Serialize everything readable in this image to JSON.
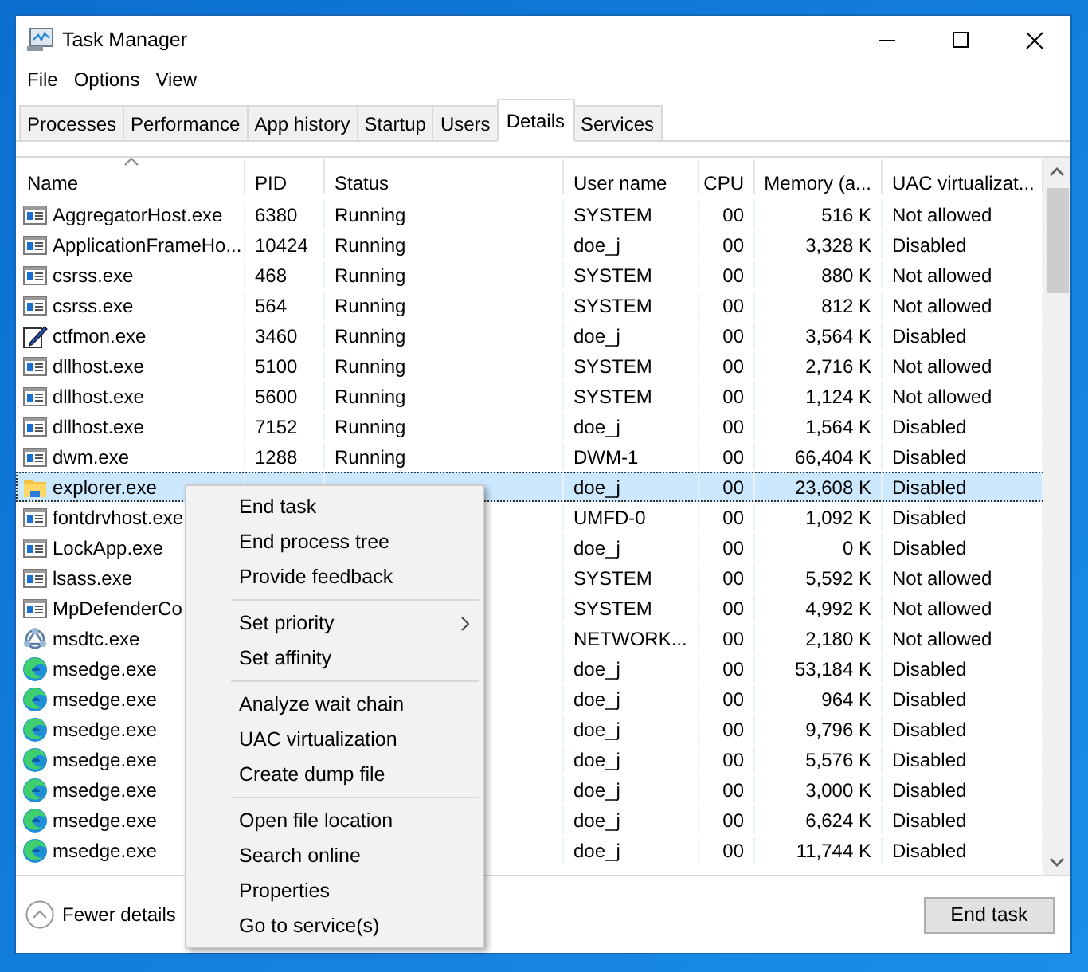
{
  "window": {
    "title": "Task Manager"
  },
  "menu_bar": [
    "File",
    "Options",
    "View"
  ],
  "tabs": [
    {
      "label": "Processes",
      "selected": false
    },
    {
      "label": "Performance",
      "selected": false
    },
    {
      "label": "App history",
      "selected": false
    },
    {
      "label": "Startup",
      "selected": false
    },
    {
      "label": "Users",
      "selected": false
    },
    {
      "label": "Details",
      "selected": true
    },
    {
      "label": "Services",
      "selected": false
    }
  ],
  "table": {
    "columns": [
      {
        "label": "Name",
        "sorted": true
      },
      {
        "label": "PID",
        "sorted": false
      },
      {
        "label": "Status",
        "sorted": false
      },
      {
        "label": "User name",
        "sorted": false
      },
      {
        "label": "CPU",
        "sorted": false
      },
      {
        "label": "Memory (a...",
        "sorted": false
      },
      {
        "label": "UAC virtualizat...",
        "sorted": false
      }
    ],
    "rows": [
      {
        "kind": "app",
        "name": "AggregatorHost.exe",
        "pid": "6380",
        "status": "Running",
        "user": "SYSTEM",
        "cpu": "00",
        "memory": "516 K",
        "uac": "Not allowed",
        "selected": false
      },
      {
        "kind": "app",
        "name": "ApplicationFrameHo...",
        "pid": "10424",
        "status": "Running",
        "user": "doe_j",
        "cpu": "00",
        "memory": "3,328 K",
        "uac": "Disabled",
        "selected": false
      },
      {
        "kind": "app",
        "name": "csrss.exe",
        "pid": "468",
        "status": "Running",
        "user": "SYSTEM",
        "cpu": "00",
        "memory": "880 K",
        "uac": "Not allowed",
        "selected": false
      },
      {
        "kind": "app",
        "name": "csrss.exe",
        "pid": "564",
        "status": "Running",
        "user": "SYSTEM",
        "cpu": "00",
        "memory": "812 K",
        "uac": "Not allowed",
        "selected": false
      },
      {
        "kind": "pen",
        "name": "ctfmon.exe",
        "pid": "3460",
        "status": "Running",
        "user": "doe_j",
        "cpu": "00",
        "memory": "3,564 K",
        "uac": "Disabled",
        "selected": false
      },
      {
        "kind": "app",
        "name": "dllhost.exe",
        "pid": "5100",
        "status": "Running",
        "user": "SYSTEM",
        "cpu": "00",
        "memory": "2,716 K",
        "uac": "Not allowed",
        "selected": false
      },
      {
        "kind": "app",
        "name": "dllhost.exe",
        "pid": "5600",
        "status": "Running",
        "user": "SYSTEM",
        "cpu": "00",
        "memory": "1,124 K",
        "uac": "Not allowed",
        "selected": false
      },
      {
        "kind": "app",
        "name": "dllhost.exe",
        "pid": "7152",
        "status": "Running",
        "user": "doe_j",
        "cpu": "00",
        "memory": "1,564 K",
        "uac": "Disabled",
        "selected": false
      },
      {
        "kind": "app",
        "name": "dwm.exe",
        "pid": "1288",
        "status": "Running",
        "user": "DWM-1",
        "cpu": "00",
        "memory": "66,404 K",
        "uac": "Disabled",
        "selected": false
      },
      {
        "kind": "folder",
        "name": "explorer.exe",
        "user": "doe_j",
        "cpu": "00",
        "memory": "23,608 K",
        "uac": "Disabled",
        "selected": true
      },
      {
        "kind": "app",
        "name": "fontdrvhost.exe",
        "user": "UMFD-0",
        "cpu": "00",
        "memory": "1,092 K",
        "uac": "Disabled",
        "selected": false
      },
      {
        "kind": "app",
        "name": "LockApp.exe",
        "user": "doe_j",
        "cpu": "00",
        "memory": "0 K",
        "uac": "Disabled",
        "selected": false
      },
      {
        "kind": "app",
        "name": "lsass.exe",
        "user": "SYSTEM",
        "cpu": "00",
        "memory": "5,592 K",
        "uac": "Not allowed",
        "selected": false
      },
      {
        "kind": "app",
        "name": "MpDefenderCo",
        "user": "SYSTEM",
        "cpu": "00",
        "memory": "4,992 K",
        "uac": "Not allowed",
        "selected": false
      },
      {
        "kind": "network",
        "name": "msdtc.exe",
        "user": "NETWORK...",
        "cpu": "00",
        "memory": "2,180 K",
        "uac": "Not allowed",
        "selected": false
      },
      {
        "kind": "edge",
        "name": "msedge.exe",
        "user": "doe_j",
        "cpu": "00",
        "memory": "53,184 K",
        "uac": "Disabled",
        "selected": false
      },
      {
        "kind": "edge",
        "name": "msedge.exe",
        "user": "doe_j",
        "cpu": "00",
        "memory": "964 K",
        "uac": "Disabled",
        "selected": false
      },
      {
        "kind": "edge",
        "name": "msedge.exe",
        "user": "doe_j",
        "cpu": "00",
        "memory": "9,796 K",
        "uac": "Disabled",
        "selected": false
      },
      {
        "kind": "edge",
        "name": "msedge.exe",
        "user": "doe_j",
        "cpu": "00",
        "memory": "5,576 K",
        "uac": "Disabled",
        "selected": false
      },
      {
        "kind": "edge",
        "name": "msedge.exe",
        "user": "doe_j",
        "cpu": "00",
        "memory": "3,000 K",
        "uac": "Disabled",
        "selected": false
      },
      {
        "kind": "edge",
        "name": "msedge.exe",
        "user": "doe_j",
        "cpu": "00",
        "memory": "6,624 K",
        "uac": "Disabled",
        "selected": false
      },
      {
        "kind": "edge",
        "name": "msedge.exe",
        "user": "doe_j",
        "cpu": "00",
        "memory": "11,744 K",
        "uac": "Disabled",
        "selected": false
      }
    ]
  },
  "context_menu": {
    "groups": [
      [
        {
          "label": "End task",
          "submenu": false
        },
        {
          "label": "End process tree",
          "submenu": false
        },
        {
          "label": "Provide feedback",
          "submenu": false
        }
      ],
      [
        {
          "label": "Set priority",
          "submenu": true
        },
        {
          "label": "Set affinity",
          "submenu": false
        }
      ],
      [
        {
          "label": "Analyze wait chain",
          "submenu": false
        },
        {
          "label": "UAC virtualization",
          "submenu": false
        },
        {
          "label": "Create dump file",
          "submenu": false
        }
      ],
      [
        {
          "label": "Open file location",
          "submenu": false
        },
        {
          "label": "Search online",
          "submenu": false
        },
        {
          "label": "Properties",
          "submenu": false
        },
        {
          "label": "Go to service(s)",
          "submenu": false
        }
      ]
    ]
  },
  "footer": {
    "details_toggle": "Fewer details",
    "end_task_button": "End task"
  }
}
